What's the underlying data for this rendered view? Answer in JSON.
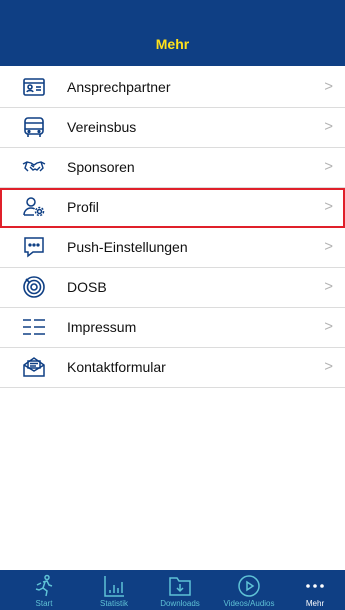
{
  "header": {
    "title": "Mehr"
  },
  "menu": {
    "items": [
      {
        "label": "Ansprechpartner",
        "icon": "contact-card-icon"
      },
      {
        "label": "Vereinsbus",
        "icon": "bus-icon"
      },
      {
        "label": "Sponsoren",
        "icon": "handshake-icon"
      },
      {
        "label": "Profil",
        "icon": "user-settings-icon"
      },
      {
        "label": "Push-Einstellungen",
        "icon": "chat-bubble-icon"
      },
      {
        "label": "DOSB",
        "icon": "target-icon"
      },
      {
        "label": "Impressum",
        "icon": "list-lines-icon"
      },
      {
        "label": "Kontaktformular",
        "icon": "envelope-icon"
      }
    ],
    "chevron": ">"
  },
  "tabbar": {
    "tabs": [
      {
        "label": "Start",
        "icon": "runner-icon"
      },
      {
        "label": "Statistik",
        "icon": "bar-chart-icon"
      },
      {
        "label": "Downloads",
        "icon": "download-icon"
      },
      {
        "label": "Videos/Audios",
        "icon": "play-icon"
      },
      {
        "label": "Mehr",
        "icon": "more-icon",
        "active": true
      }
    ]
  },
  "colors": {
    "header_bg": "#0f3f84",
    "header_title": "#ffe11a",
    "icon_blue": "#0f3f84",
    "tab_inactive": "#5fc2d6",
    "tab_active": "#ffffff",
    "highlight_border": "#e0202a"
  }
}
